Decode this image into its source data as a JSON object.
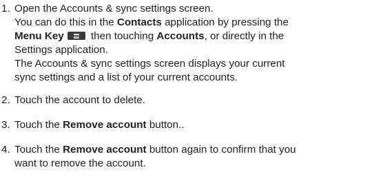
{
  "steps": [
    {
      "number": "1.",
      "title": "Open the Accounts & sync settings screen.",
      "detail": {
        "t1": "You can do this in the ",
        "contacts": "Contacts",
        "t2": " application by pressing the",
        "menu_key": "Menu Key",
        "t3": " then touching ",
        "accounts": "Accounts",
        "t4": ", or directly in the",
        "t5": "Settings application.",
        "t6": "The Accounts & sync settings screen displays your current",
        "t7": "sync settings and a list of your current accounts."
      }
    },
    {
      "number": "2.",
      "text": "Touch the account to delete."
    },
    {
      "number": "3.",
      "t1": "Touch the ",
      "button": "Remove account",
      "t2": " button.."
    },
    {
      "number": "4.",
      "t1": "Touch the ",
      "button": "Remove account",
      "t2": " button again to confirm that you",
      "t3": "want to remove the account."
    }
  ],
  "icons": {
    "menu_key": "menu-key-icon"
  },
  "colors": {
    "text": "#222222",
    "icon": "#3a3a3a"
  }
}
